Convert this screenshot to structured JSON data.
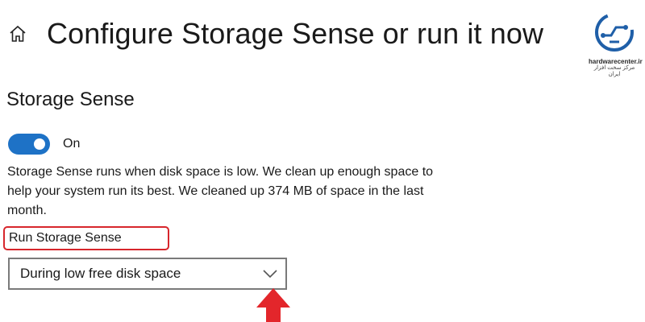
{
  "header": {
    "title": "Configure Storage Sense or run it now"
  },
  "logo": {
    "site": "hardwarecenter.ir",
    "tagline": "مرکز سخت افزار ایران"
  },
  "storage_sense": {
    "section_title": "Storage Sense",
    "toggle_state": "On",
    "description": "Storage Sense runs when disk space is low. We clean up enough space to help your system run its best. We cleaned up 374 MB of space in the last month.",
    "run_label": "Run Storage Sense",
    "run_selected": "During low free disk space"
  },
  "colors": {
    "accent": "#1e72c6",
    "highlight": "#d7262c"
  }
}
